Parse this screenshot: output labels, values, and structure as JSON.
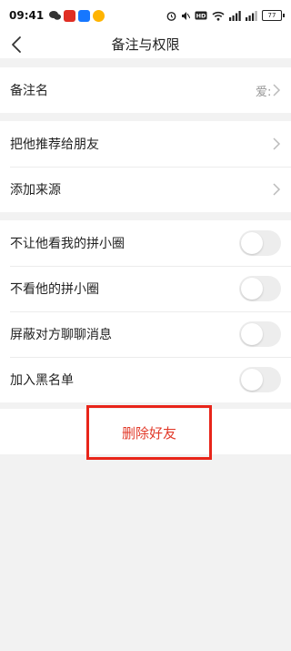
{
  "status_bar": {
    "time": "09:41",
    "battery": "77",
    "notification_icons": [
      {
        "name": "wechat-icon",
        "color": "#333333"
      },
      {
        "name": "pdd-icon",
        "color": "#e02e24"
      },
      {
        "name": "alipay-icon",
        "color": "#1677ff"
      },
      {
        "name": "taobao-icon",
        "color": "#ffb400"
      }
    ]
  },
  "nav": {
    "title": "备注与权限"
  },
  "sections": {
    "remark": {
      "label": "备注名",
      "value": "爱:"
    },
    "friend": {
      "recommend_label": "把他推荐给朋友",
      "source_label": "添加来源"
    },
    "privacy": {
      "items": [
        {
          "label": "不让他看我的拼小圈",
          "enabled": false
        },
        {
          "label": "不看他的拼小圈",
          "enabled": false
        },
        {
          "label": "屏蔽对方聊聊消息",
          "enabled": false
        },
        {
          "label": "加入黑名单",
          "enabled": false
        }
      ]
    }
  },
  "delete_button": {
    "label": "删除好友",
    "color": "#e23b2b",
    "highlight_color": "#e8251a"
  }
}
